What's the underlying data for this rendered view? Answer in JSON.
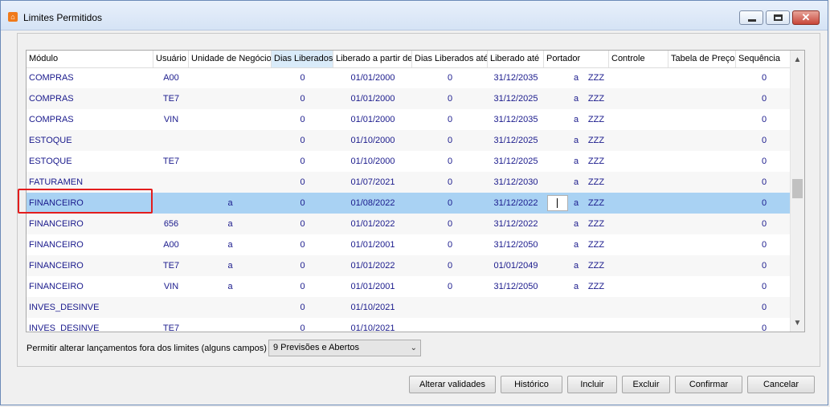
{
  "window": {
    "title": "Limites Permitidos"
  },
  "columns": [
    {
      "label": "Módulo"
    },
    {
      "label": "Usuário"
    },
    {
      "label": "Unidade de Negócio"
    },
    {
      "label": "Dias Liberados"
    },
    {
      "label": "Liberado a partir de"
    },
    {
      "label": "Dias Liberados até"
    },
    {
      "label": "Liberado até"
    },
    {
      "label": "Portador"
    },
    {
      "label": "Controle"
    },
    {
      "label": "Tabela de Preço"
    },
    {
      "label": "Sequência"
    }
  ],
  "rows": [
    {
      "modulo": "COMPRAS",
      "usuario": "A00",
      "unidade": "",
      "dias": "0",
      "partir": "01/01/2000",
      "dias_ate": "0",
      "ate": "31/12/2035",
      "portador": "a",
      "controle": "ZZZ",
      "seq": "0"
    },
    {
      "modulo": "COMPRAS",
      "usuario": "TE7",
      "unidade": "",
      "dias": "0",
      "partir": "01/01/2000",
      "dias_ate": "0",
      "ate": "31/12/2025",
      "portador": "a",
      "controle": "ZZZ",
      "seq": "0"
    },
    {
      "modulo": "COMPRAS",
      "usuario": "VIN",
      "unidade": "",
      "dias": "0",
      "partir": "01/01/2000",
      "dias_ate": "0",
      "ate": "31/12/2035",
      "portador": "a",
      "controle": "ZZZ",
      "seq": "0"
    },
    {
      "modulo": "ESTOQUE",
      "usuario": "",
      "unidade": "",
      "dias": "0",
      "partir": "01/10/2000",
      "dias_ate": "0",
      "ate": "31/12/2025",
      "portador": "a",
      "controle": "ZZZ",
      "seq": "0"
    },
    {
      "modulo": "ESTOQUE",
      "usuario": "TE7",
      "unidade": "",
      "dias": "0",
      "partir": "01/10/2000",
      "dias_ate": "0",
      "ate": "31/12/2025",
      "portador": "a",
      "controle": "ZZZ",
      "seq": "0"
    },
    {
      "modulo": "FATURAMEN",
      "usuario": "",
      "unidade": "",
      "dias": "0",
      "partir": "01/07/2021",
      "dias_ate": "0",
      "ate": "31/12/2030",
      "portador": "a",
      "controle": "ZZZ",
      "seq": "0"
    },
    {
      "modulo": "FINANCEIRO",
      "usuario": "",
      "unidade": "a",
      "dias": "0",
      "partir": "01/08/2022",
      "dias_ate": "0",
      "ate": "31/12/2022",
      "portador": "a",
      "controle": "ZZZ",
      "seq": "0",
      "selected": true
    },
    {
      "modulo": "FINANCEIRO",
      "usuario": "656",
      "unidade": "a",
      "dias": "0",
      "partir": "01/01/2022",
      "dias_ate": "0",
      "ate": "31/12/2022",
      "portador": "a",
      "controle": "ZZZ",
      "seq": "0"
    },
    {
      "modulo": "FINANCEIRO",
      "usuario": "A00",
      "unidade": "a",
      "dias": "0",
      "partir": "01/01/2001",
      "dias_ate": "0",
      "ate": "31/12/2050",
      "portador": "a",
      "controle": "ZZZ",
      "seq": "0"
    },
    {
      "modulo": "FINANCEIRO",
      "usuario": "TE7",
      "unidade": "a",
      "dias": "0",
      "partir": "01/01/2022",
      "dias_ate": "0",
      "ate": "01/01/2049",
      "portador": "a",
      "controle": "ZZZ",
      "seq": "0"
    },
    {
      "modulo": "FINANCEIRO",
      "usuario": "VIN",
      "unidade": "a",
      "dias": "0",
      "partir": "01/01/2001",
      "dias_ate": "0",
      "ate": "31/12/2050",
      "portador": "a",
      "controle": "ZZZ",
      "seq": "0"
    },
    {
      "modulo": "INVES_DESINVE",
      "usuario": "",
      "unidade": "",
      "dias": "0",
      "partir": "01/10/2021",
      "dias_ate": "",
      "ate": "",
      "portador": "",
      "controle": "",
      "seq": "0"
    },
    {
      "modulo": "INVES_DESINVE",
      "usuario": "TE7",
      "unidade": "",
      "dias": "0",
      "partir": "01/10/2021",
      "dias_ate": "",
      "ate": "",
      "portador": "",
      "controle": "",
      "seq": "0"
    }
  ],
  "option": {
    "label": "Permitir alterar lançamentos fora dos limites (alguns campos)",
    "selected": "9 Previsões e Abertos"
  },
  "buttons": {
    "alterar": "Alterar validades",
    "historico": "Histórico",
    "incluir": "Incluir",
    "excluir": "Excluir",
    "confirmar": "Confirmar",
    "cancelar": "Cancelar"
  }
}
